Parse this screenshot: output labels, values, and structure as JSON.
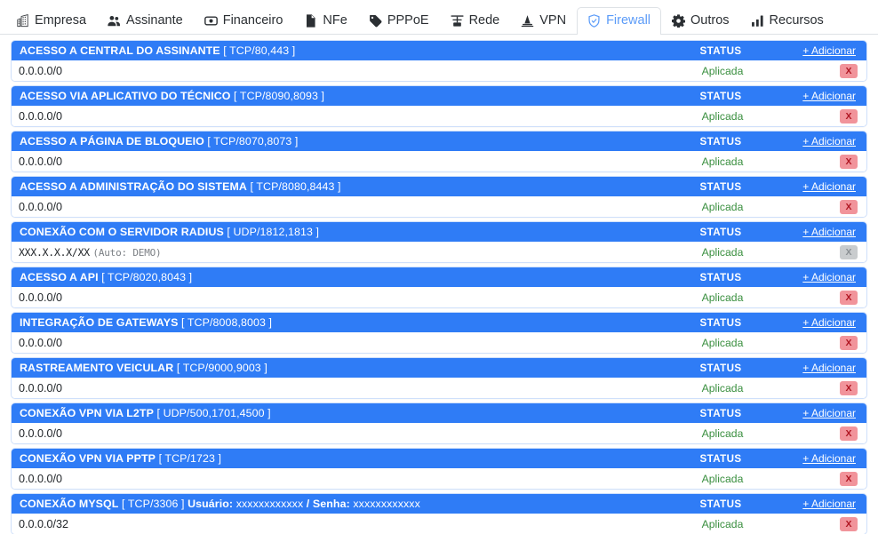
{
  "nav": {
    "items": [
      {
        "label": "Empresa",
        "icon": "building-icon",
        "active": false
      },
      {
        "label": "Assinante",
        "icon": "people-icon",
        "active": false
      },
      {
        "label": "Financeiro",
        "icon": "cash-icon",
        "active": false
      },
      {
        "label": "NFe",
        "icon": "document-icon",
        "active": false
      },
      {
        "label": "PPPoE",
        "icon": "tag-icon",
        "active": false
      },
      {
        "label": "Rede",
        "icon": "network-icon",
        "active": false
      },
      {
        "label": "VPN",
        "icon": "cone-icon",
        "active": false
      },
      {
        "label": "Firewall",
        "icon": "shield-icon",
        "active": true
      },
      {
        "label": "Outros",
        "icon": "gear-icon",
        "active": false
      },
      {
        "label": "Recursos",
        "icon": "bar-chart-icon",
        "active": false
      }
    ]
  },
  "colors": {
    "header_blue": "#2f7cf6",
    "active_tab_text": "#5b9bf8",
    "status_green": "#3a8f3f",
    "delete_btn": "#f1949b",
    "delete_btn_disabled": "#c9ccce",
    "card_border": "#cfe0fb"
  },
  "labels": {
    "status": "STATUS",
    "add": "+ Adicionar",
    "delete": "X"
  },
  "rules": [
    {
      "title": "ACESSO A CENTRAL DO ASSINANTE",
      "ports": "[ TCP/80,443 ]",
      "extra": "",
      "value": "0.0.0.0/0",
      "value_note": "",
      "status": "STATUS",
      "add": "+ Adicionar",
      "state": "Aplicada",
      "delete": "X",
      "delete_disabled": false
    },
    {
      "title": "ACESSO VIA APLICATIVO DO TÉCNICO",
      "ports": "[ TCP/8090,8093 ]",
      "extra": "",
      "value": "0.0.0.0/0",
      "value_note": "",
      "status": "STATUS",
      "add": "+ Adicionar",
      "state": "Aplicada",
      "delete": "X",
      "delete_disabled": false
    },
    {
      "title": "ACESSO A PÁGINA DE BLOQUEIO",
      "ports": "[ TCP/8070,8073 ]",
      "extra": "",
      "value": "0.0.0.0/0",
      "value_note": "",
      "status": "STATUS",
      "add": "+ Adicionar",
      "state": "Aplicada",
      "delete": "X",
      "delete_disabled": false
    },
    {
      "title": "ACESSO A ADMINISTRAÇÃO DO SISTEMA",
      "ports": "[ TCP/8080,8443 ]",
      "extra": "",
      "value": "0.0.0.0/0",
      "value_note": "",
      "status": "STATUS",
      "add": "+ Adicionar",
      "state": "Aplicada",
      "delete": "X",
      "delete_disabled": false
    },
    {
      "title": "CONEXÃO COM O SERVIDOR RADIUS",
      "ports": "[ UDP/1812,1813 ]",
      "extra": "",
      "value": "XXX.X.X.X/XX",
      "value_note": "(Auto: DEMO)",
      "status": "STATUS",
      "add": "+ Adicionar",
      "state": "Aplicada",
      "delete": "X",
      "delete_disabled": true
    },
    {
      "title": "ACESSO A API",
      "ports": "[ TCP/8020,8043 ]",
      "extra": "",
      "value": "0.0.0.0/0",
      "value_note": "",
      "status": "STATUS",
      "add": "+ Adicionar",
      "state": "Aplicada",
      "delete": "X",
      "delete_disabled": false
    },
    {
      "title": "INTEGRAÇÃO DE GATEWAYS",
      "ports": "[ TCP/8008,8003 ]",
      "extra": "",
      "value": "0.0.0.0/0",
      "value_note": "",
      "status": "STATUS",
      "add": "+ Adicionar",
      "state": "Aplicada",
      "delete": "X",
      "delete_disabled": false
    },
    {
      "title": "RASTREAMENTO VEICULAR",
      "ports": "[ TCP/9000,9003 ]",
      "extra": "",
      "value": "0.0.0.0/0",
      "value_note": "",
      "status": "STATUS",
      "add": "+ Adicionar",
      "state": "Aplicada",
      "delete": "X",
      "delete_disabled": false
    },
    {
      "title": "CONEXÃO VPN VIA L2TP",
      "ports": "[ UDP/500,1701,4500 ]",
      "extra": "",
      "value": "0.0.0.0/0",
      "value_note": "",
      "status": "STATUS",
      "add": "+ Adicionar",
      "state": "Aplicada",
      "delete": "X",
      "delete_disabled": false
    },
    {
      "title": "CONEXÃO VPN VIA PPTP",
      "ports": "[ TCP/1723 ]",
      "extra": "",
      "value": "0.0.0.0/0",
      "value_note": "",
      "status": "STATUS",
      "add": "+ Adicionar",
      "state": "Aplicada",
      "delete": "X",
      "delete_disabled": false
    },
    {
      "title": "CONEXÃO MYSQL",
      "ports": "[ TCP/3306 ]",
      "extra_bold_1": "Usuário:",
      "extra_val_1": "xxxxxxxxxxxx",
      "extra_sep": "/",
      "extra_bold_2": "Senha:",
      "extra_val_2": "xxxxxxxxxxxx",
      "value": "0.0.0.0/32",
      "value_note": "",
      "status": "STATUS",
      "add": "+ Adicionar",
      "state": "Aplicada",
      "delete": "X",
      "delete_disabled": false
    }
  ]
}
